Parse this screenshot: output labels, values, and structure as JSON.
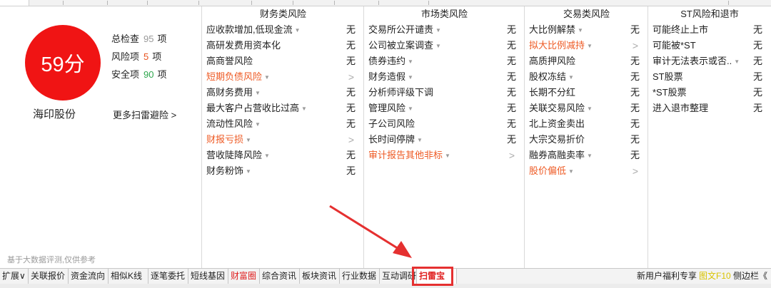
{
  "score": {
    "value": "59分",
    "color": "#f01414"
  },
  "stats": [
    {
      "label": "总检查",
      "value": "95",
      "unit": "项",
      "color": "#999999"
    },
    {
      "label": "风险项",
      "value": "5",
      "unit": "项",
      "color": "#e8531f"
    },
    {
      "label": "安全项",
      "value": "90",
      "unit": "项",
      "color": "#2ea64d"
    }
  ],
  "stock_name": "海印股份",
  "more_link": "更多扫雷避险 >",
  "footnote": "基于大数据评测,仅供参考",
  "columns": [
    {
      "title": "财务类风险",
      "rows": [
        {
          "label": "应收款增加,低现金流",
          "value": "无",
          "risk": false,
          "dropdown": true
        },
        {
          "label": "高研发费用资本化",
          "value": "无",
          "risk": false,
          "dropdown": false
        },
        {
          "label": "高商誉风险",
          "value": "无",
          "risk": false,
          "dropdown": false
        },
        {
          "label": "短期负债风险",
          "value": ">",
          "risk": true,
          "dropdown": true
        },
        {
          "label": "高财务费用",
          "value": "无",
          "risk": false,
          "dropdown": true
        },
        {
          "label": "最大客户占营收比过高",
          "value": "无",
          "risk": false,
          "dropdown": true
        },
        {
          "label": "流动性风险",
          "value": "无",
          "risk": false,
          "dropdown": true
        },
        {
          "label": "财报亏损",
          "value": ">",
          "risk": true,
          "dropdown": true
        },
        {
          "label": "营收陡降风险",
          "value": "无",
          "risk": false,
          "dropdown": true
        },
        {
          "label": "财务粉饰",
          "value": "无",
          "risk": false,
          "dropdown": true
        }
      ]
    },
    {
      "title": "市场类风险",
      "rows": [
        {
          "label": "交易所公开谴责",
          "value": "无",
          "risk": false,
          "dropdown": true
        },
        {
          "label": "公司被立案调查",
          "value": "无",
          "risk": false,
          "dropdown": true
        },
        {
          "label": "债券违约",
          "value": "无",
          "risk": false,
          "dropdown": true
        },
        {
          "label": "财务造假",
          "value": "无",
          "risk": false,
          "dropdown": true
        },
        {
          "label": "分析师评级下调",
          "value": "无",
          "risk": false,
          "dropdown": false
        },
        {
          "label": "管理风险",
          "value": "无",
          "risk": false,
          "dropdown": true
        },
        {
          "label": "子公司风险",
          "value": "无",
          "risk": false,
          "dropdown": false
        },
        {
          "label": "长时间停牌",
          "value": "无",
          "risk": false,
          "dropdown": true
        },
        {
          "label": "审计报告其他非标",
          "value": ">",
          "risk": true,
          "dropdown": true
        }
      ]
    },
    {
      "title": "交易类风险",
      "rows": [
        {
          "label": "大比例解禁",
          "value": "无",
          "risk": false,
          "dropdown": true
        },
        {
          "label": "拟大比例减持",
          "value": ">",
          "risk": true,
          "dropdown": true
        },
        {
          "label": "高质押风险",
          "value": "无",
          "risk": false,
          "dropdown": false
        },
        {
          "label": "股权冻结",
          "value": "无",
          "risk": false,
          "dropdown": true
        },
        {
          "label": "长期不分红",
          "value": "无",
          "risk": false,
          "dropdown": false
        },
        {
          "label": "关联交易风险",
          "value": "无",
          "risk": false,
          "dropdown": true
        },
        {
          "label": "北上资金卖出",
          "value": "无",
          "risk": false,
          "dropdown": false
        },
        {
          "label": "大宗交易折价",
          "value": "无",
          "risk": false,
          "dropdown": false
        },
        {
          "label": "融券高融卖率",
          "value": "无",
          "risk": false,
          "dropdown": true
        },
        {
          "label": "股价偏低",
          "value": ">",
          "risk": true,
          "dropdown": true
        }
      ]
    },
    {
      "title": "ST风险和退市",
      "rows": [
        {
          "label": "可能终止上市",
          "value": "无",
          "risk": false,
          "dropdown": false
        },
        {
          "label": "可能被*ST",
          "value": "无",
          "risk": false,
          "dropdown": false
        },
        {
          "label": "审计无法表示或否..",
          "value": "无",
          "risk": false,
          "dropdown": true
        },
        {
          "label": "ST股票",
          "value": "无",
          "risk": false,
          "dropdown": false
        },
        {
          "label": "*ST股票",
          "value": "无",
          "risk": false,
          "dropdown": false
        },
        {
          "label": "进入退市整理",
          "value": "无",
          "risk": false,
          "dropdown": false
        }
      ]
    }
  ],
  "tabs": [
    {
      "label": "扩展∨",
      "w": 40,
      "style": ""
    },
    {
      "label": "关联报价",
      "w": 56,
      "style": ""
    },
    {
      "label": "资金流向",
      "w": 56,
      "style": ""
    },
    {
      "label": "相似K线",
      "w": 56,
      "style": ""
    },
    {
      "label": "逐笔委托",
      "w": 56,
      "style": ""
    },
    {
      "label": "短线基因",
      "w": 56,
      "style": ""
    },
    {
      "label": "财富圈",
      "w": 44,
      "style": "red"
    },
    {
      "label": "综合资讯",
      "w": 56,
      "style": ""
    },
    {
      "label": "板块资讯",
      "w": 56,
      "style": ""
    },
    {
      "label": "行业数据",
      "w": 56,
      "style": ""
    },
    {
      "label": "互动调研",
      "w": 52,
      "style": ""
    },
    {
      "label": "扫雷宝",
      "w": 56,
      "style": "active"
    }
  ],
  "right_bar": [
    {
      "label": "新用户福利专享",
      "color": "#222222"
    },
    {
      "label": "图文F10",
      "color": "#d9c300"
    },
    {
      "label": "侧边栏《",
      "color": "#222222"
    }
  ],
  "colors": {
    "accent_red": "#e53030",
    "risk_orange": "#ee5a24",
    "neutral": "#222222"
  }
}
